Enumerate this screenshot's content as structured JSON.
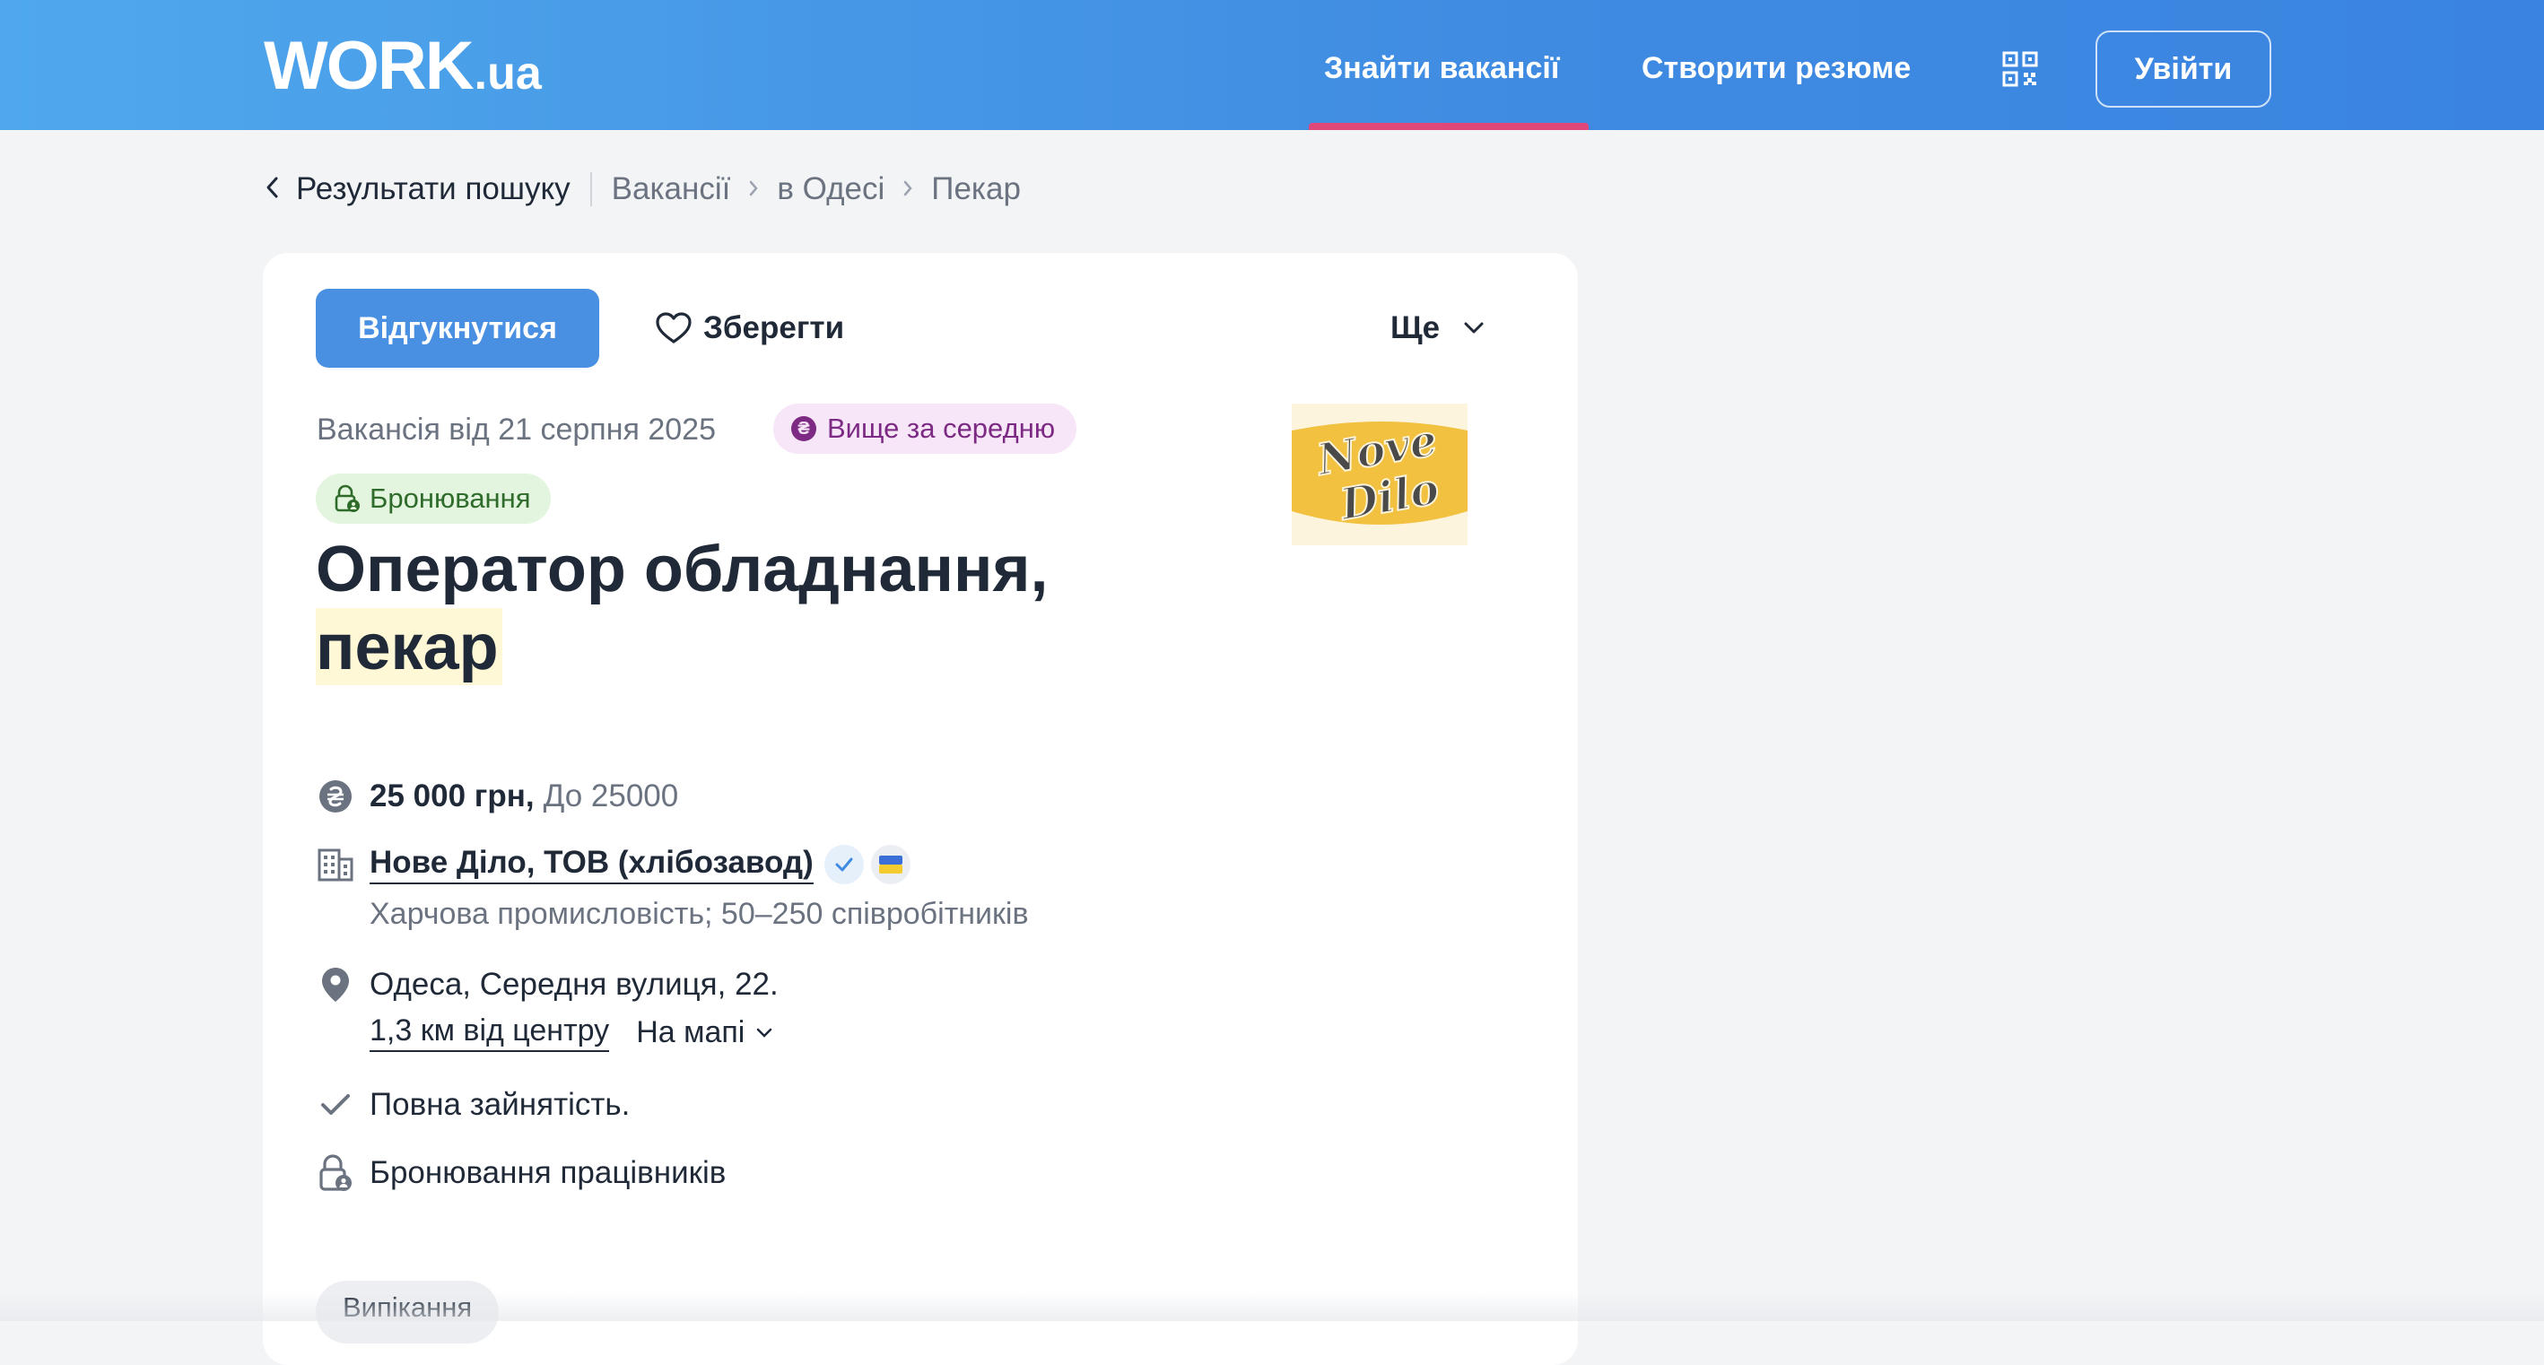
{
  "header": {
    "logo_main": "WORK",
    "logo_domain": ".ua",
    "nav_find": "Знайти вакансії",
    "nav_resume": "Створити резюме",
    "login": "Увійти"
  },
  "breadcrumb": {
    "back": "Результати пошуку",
    "items": [
      "Вакансії",
      "в Одесі",
      "Пекар"
    ]
  },
  "actions": {
    "apply": "Відгукнутися",
    "save": "Зберегти",
    "more": "Ще"
  },
  "vacancy": {
    "date": "Вакансія від 21 серпня 2025",
    "badge_salary": "Вище за середню",
    "badge_booking": "Бронювання",
    "title_line1": "Оператор обладнання,",
    "title_line2": "пекар",
    "salary_bold": "25 000 грн,",
    "salary_range": "До 25000",
    "company": "Нове Діло, ТОВ (хлібозавод)",
    "company_info": "Харчова промисловість; 50–250 співробітників",
    "address": "Одеса, Середня вулиця, 22.",
    "distance": "1,3 км від центру",
    "on_map": "На мапі",
    "employment": "Повна зайнятість.",
    "booking_workers": "Бронювання працівників",
    "tag": "Випікання"
  },
  "logo_text": {
    "line1": "Nove",
    "line2": "Dilo"
  },
  "colors": {
    "header_blue": "#3f8be2",
    "accent_pink": "#e0487a",
    "apply_blue": "#4a90e2",
    "salary_badge_bg": "#f6e6f7",
    "booking_badge_bg": "#e3f5de"
  }
}
